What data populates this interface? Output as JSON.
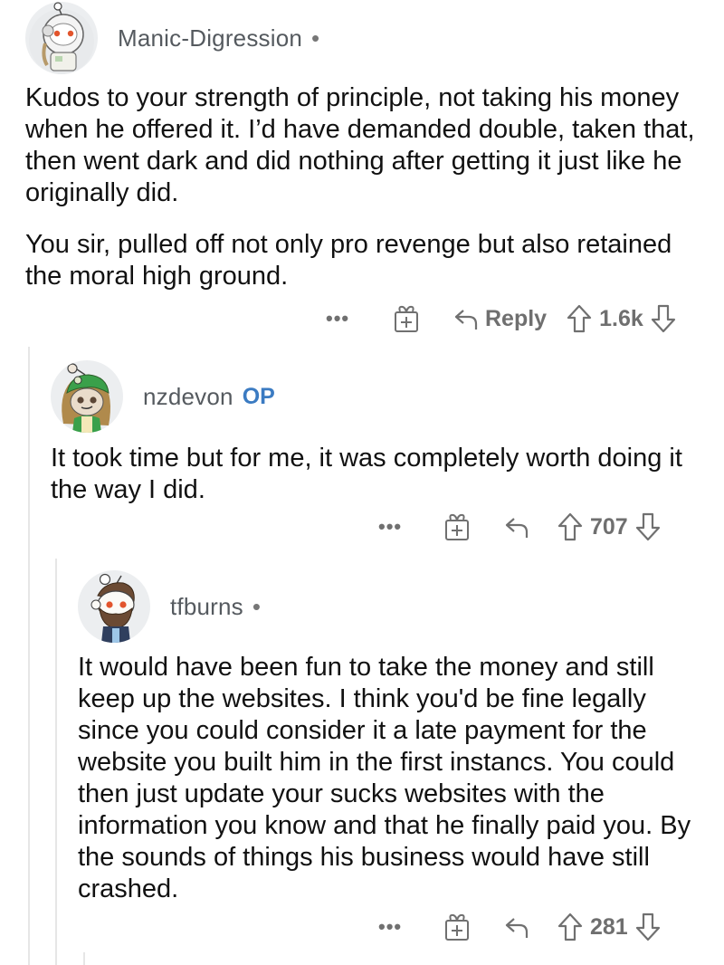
{
  "accent": {
    "op_badge": "#3b7bc2",
    "thread_line": "#e6e6e6",
    "action_gray": "#707070"
  },
  "comments": [
    {
      "username": "Manic-Digression",
      "separator": "•",
      "avatar_icon": "snoo-astronaut-avatar",
      "paragraphs": [
        "Kudos to your strength of principle, not taking his money when he offered it. I’d have demanded double, taken that, then went dark and did nothing after getting it just like he originally did.",
        "You sir, pulled off not only pro revenge but also retained the moral high ground."
      ],
      "actions": {
        "more": "•••",
        "reply_label": "Reply",
        "score": "1.6k"
      }
    },
    {
      "username": "nzdevon",
      "badge": "OP",
      "avatar_icon": "snoo-frog-hood-avatar",
      "paragraphs": [
        "It took time but for me, it was completely worth doing it the way I did."
      ],
      "actions": {
        "more": "•••",
        "score": "707"
      }
    },
    {
      "username": "tfburns",
      "separator": "•",
      "avatar_icon": "snoo-bearded-avatar",
      "paragraphs": [
        "It would have been fun to take the money and still keep up the websites. I think you'd be fine legally since you could consider it a late payment for the website you built him in the first instancs. You could then just update your sucks websites with the information you know and that he finally paid you. By the sounds of things his business would have still crashed."
      ],
      "actions": {
        "more": "•••",
        "score": "281"
      }
    }
  ]
}
